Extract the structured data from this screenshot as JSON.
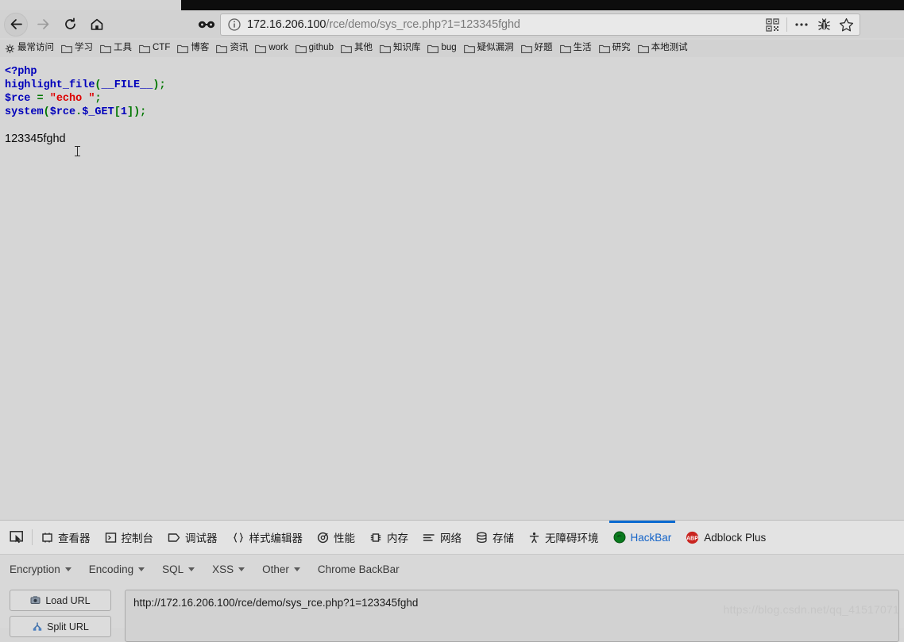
{
  "browser": {
    "nav": {
      "back_label": "Back",
      "forward_label": "Forward",
      "reload_label": "Reload",
      "home_label": "Home"
    },
    "url_bar": {
      "host": "172.16.206.100",
      "path": "/rce/demo/sys_rce.php?1=123345fghd",
      "full_url": "172.16.206.100/rce/demo/sys_rce.php?1=123345fghd",
      "info_icon": "info-icon",
      "container_icon": "glasses-icon",
      "right_icons": [
        "qr-code-icon",
        "page-actions-icon",
        "hackbar-bug-icon",
        "bookmark-star-icon"
      ]
    },
    "bookmarks": [
      {
        "label": "最常访问",
        "icon": "star-gear-icon"
      },
      {
        "label": "学习",
        "icon": "folder-icon"
      },
      {
        "label": "工具",
        "icon": "folder-icon"
      },
      {
        "label": "CTF",
        "icon": "folder-icon"
      },
      {
        "label": "博客",
        "icon": "folder-icon"
      },
      {
        "label": "资讯",
        "icon": "folder-icon"
      },
      {
        "label": "work",
        "icon": "folder-icon"
      },
      {
        "label": "github",
        "icon": "folder-icon"
      },
      {
        "label": "其他",
        "icon": "folder-icon"
      },
      {
        "label": "知识库",
        "icon": "folder-icon"
      },
      {
        "label": "bug",
        "icon": "folder-icon"
      },
      {
        "label": "疑似漏洞",
        "icon": "folder-icon"
      },
      {
        "label": "好题",
        "icon": "folder-icon"
      },
      {
        "label": "生活",
        "icon": "folder-icon"
      },
      {
        "label": "研究",
        "icon": "folder-icon"
      },
      {
        "label": "本地测试",
        "icon": "folder-icon"
      }
    ]
  },
  "page": {
    "code": {
      "line1": "<?php",
      "line2_a": "highlight_file",
      "line2_b": "(",
      "line2_c": "__FILE__",
      "line2_d": ");",
      "line3_a": "$rce",
      "line3_b": " = ",
      "line3_c": "\"echo \"",
      "line3_d": ";",
      "line4_a": "system",
      "line4_b": "(",
      "line4_c": "$rce",
      "line4_d": ".",
      "line4_e": "$_GET",
      "line4_f": "[",
      "line4_g": "1",
      "line4_h": "]);"
    },
    "output": "123345fghd"
  },
  "devtools": {
    "picker_icon": "element-picker-icon",
    "tabs": [
      {
        "label": "查看器",
        "icon": "inspector-icon",
        "active": false
      },
      {
        "label": "控制台",
        "icon": "console-icon",
        "active": false
      },
      {
        "label": "调试器",
        "icon": "debugger-icon",
        "active": false
      },
      {
        "label": "样式编辑器",
        "icon": "style-editor-icon",
        "active": false
      },
      {
        "label": "性能",
        "icon": "performance-icon",
        "active": false
      },
      {
        "label": "内存",
        "icon": "memory-icon",
        "active": false
      },
      {
        "label": "网络",
        "icon": "network-icon",
        "active": false
      },
      {
        "label": "存储",
        "icon": "storage-icon",
        "active": false
      },
      {
        "label": "无障碍环境",
        "icon": "accessibility-icon",
        "active": false
      },
      {
        "label": "HackBar",
        "icon": "hackbar-icon",
        "active": true
      },
      {
        "label": "Adblock Plus",
        "icon": "adblock-plus-icon",
        "active": false
      }
    ]
  },
  "hackbar": {
    "menu": [
      {
        "label": "Encryption",
        "has_caret": true
      },
      {
        "label": "Encoding",
        "has_caret": true
      },
      {
        "label": "SQL",
        "has_caret": true
      },
      {
        "label": "XSS",
        "has_caret": true
      },
      {
        "label": "Other",
        "has_caret": true
      },
      {
        "label": "Chrome BackBar",
        "has_caret": false
      }
    ],
    "load_url_label": "Load URL",
    "split_url_label": "Split URL",
    "url_value": "http://172.16.206.100/rce/demo/sys_rce.php?1=123345fghd"
  },
  "watermark": "https://blog.csdn.net/qq_41517071",
  "colors": {
    "accent_blue": "#0b6ad0",
    "code_keyword": "#0000BB",
    "code_punct": "#007700",
    "code_string": "#DD0000",
    "page_bg": "#d6d6d6",
    "chrome_bg": "#d2d2d2"
  }
}
